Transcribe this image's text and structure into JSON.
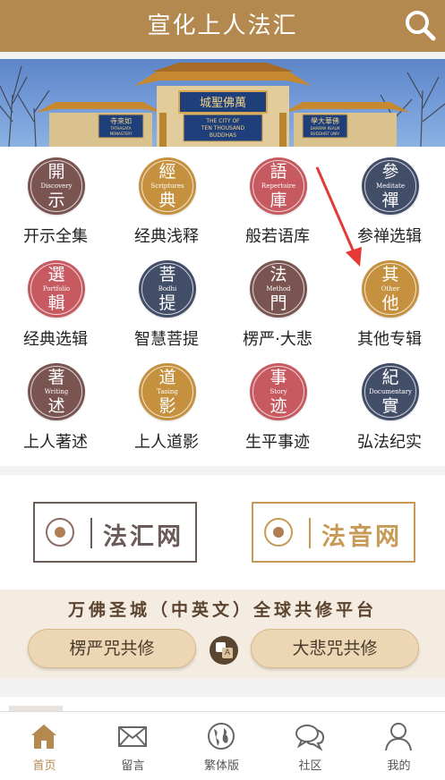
{
  "header": {
    "title": "宣化上人法汇",
    "search_icon": "search-icon"
  },
  "banner": {
    "gate_title": "城聖佛萬",
    "gate_en": [
      "THE CITY OF",
      "TEN THOUSAND",
      "BUDDHAS"
    ],
    "left_plaque": "寺來如",
    "left_plaque_en": [
      "TATHAGATA",
      "MONASTERY"
    ],
    "right_plaque": "學大華佛",
    "right_plaque_en": [
      "DHARMA REALM",
      "BUDDHIST UNIV"
    ]
  },
  "menu": [
    {
      "label": "开示全集",
      "c1": "開",
      "c2": "示",
      "en": "Discovery",
      "color": "#7a5450"
    },
    {
      "label": "经典浅释",
      "c1": "經",
      "c2": "典",
      "en": "Scriptures",
      "color": "#c6913f"
    },
    {
      "label": "般若语库",
      "c1": "語",
      "c2": "庫",
      "en": "Repertoire",
      "color": "#c65a60"
    },
    {
      "label": "参禅选辑",
      "c1": "參",
      "c2": "禪",
      "en": "Meditate",
      "color": "#424d68"
    },
    {
      "label": "经典选辑",
      "c1": "選",
      "c2": "輯",
      "en": "Portfolio",
      "color": "#c65a60"
    },
    {
      "label": "智慧菩提",
      "c1": "菩",
      "c2": "提",
      "en": "Bodhi",
      "color": "#424d68"
    },
    {
      "label": "楞严·大悲",
      "c1": "法",
      "c2": "門",
      "en": "Method",
      "color": "#7a5450"
    },
    {
      "label": "其他专辑",
      "c1": "其",
      "c2": "他",
      "en": "Other",
      "color": "#c6913f"
    },
    {
      "label": "上人著述",
      "c1": "著",
      "c2": "述",
      "en": "Writing",
      "color": "#7a5450"
    },
    {
      "label": "上人道影",
      "c1": "道",
      "c2": "影",
      "en": "Taoing",
      "color": "#c6913f"
    },
    {
      "label": "生平事迹",
      "c1": "事",
      "c2": "迹",
      "en": "Story",
      "color": "#c65a60"
    },
    {
      "label": "弘法纪实",
      "c1": "紀",
      "c2": "實",
      "en": "Documentary",
      "color": "#424d68"
    }
  ],
  "sites": {
    "left": {
      "label": "法汇网",
      "icon": "lotus-logo-icon"
    },
    "right": {
      "label": "法音网",
      "icon": "lotus-logo-icon"
    }
  },
  "platform": {
    "title": "万佛圣城（中英文）全球共修平台",
    "left_button": "楞严咒共修",
    "right_button": "大悲咒共修",
    "toggle_icon": "language-toggle-icon"
  },
  "tabs": [
    {
      "label": "首页",
      "icon": "home-icon",
      "active": true
    },
    {
      "label": "留言",
      "icon": "envelope-icon",
      "active": false
    },
    {
      "label": "繁体版",
      "icon": "globe-icon",
      "active": false
    },
    {
      "label": "社区",
      "icon": "chat-bubbles-icon",
      "active": false
    },
    {
      "label": "我的",
      "icon": "user-icon",
      "active": false
    }
  ],
  "colors": {
    "brand": "#b3894f",
    "annotation_arrow": "#e53935"
  }
}
